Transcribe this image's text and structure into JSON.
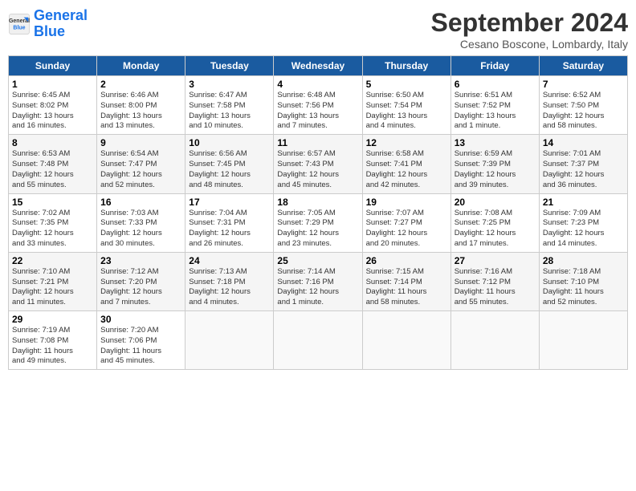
{
  "logo": {
    "line1": "General",
    "line2": "Blue"
  },
  "title": "September 2024",
  "subtitle": "Cesano Boscone, Lombardy, Italy",
  "weekdays": [
    "Sunday",
    "Monday",
    "Tuesday",
    "Wednesday",
    "Thursday",
    "Friday",
    "Saturday"
  ],
  "rows": [
    [
      {
        "day": "1",
        "lines": [
          "Sunrise: 6:45 AM",
          "Sunset: 8:02 PM",
          "Daylight: 13 hours",
          "and 16 minutes."
        ]
      },
      {
        "day": "2",
        "lines": [
          "Sunrise: 6:46 AM",
          "Sunset: 8:00 PM",
          "Daylight: 13 hours",
          "and 13 minutes."
        ]
      },
      {
        "day": "3",
        "lines": [
          "Sunrise: 6:47 AM",
          "Sunset: 7:58 PM",
          "Daylight: 13 hours",
          "and 10 minutes."
        ]
      },
      {
        "day": "4",
        "lines": [
          "Sunrise: 6:48 AM",
          "Sunset: 7:56 PM",
          "Daylight: 13 hours",
          "and 7 minutes."
        ]
      },
      {
        "day": "5",
        "lines": [
          "Sunrise: 6:50 AM",
          "Sunset: 7:54 PM",
          "Daylight: 13 hours",
          "and 4 minutes."
        ]
      },
      {
        "day": "6",
        "lines": [
          "Sunrise: 6:51 AM",
          "Sunset: 7:52 PM",
          "Daylight: 13 hours",
          "and 1 minute."
        ]
      },
      {
        "day": "7",
        "lines": [
          "Sunrise: 6:52 AM",
          "Sunset: 7:50 PM",
          "Daylight: 12 hours",
          "and 58 minutes."
        ]
      }
    ],
    [
      {
        "day": "8",
        "lines": [
          "Sunrise: 6:53 AM",
          "Sunset: 7:48 PM",
          "Daylight: 12 hours",
          "and 55 minutes."
        ]
      },
      {
        "day": "9",
        "lines": [
          "Sunrise: 6:54 AM",
          "Sunset: 7:47 PM",
          "Daylight: 12 hours",
          "and 52 minutes."
        ]
      },
      {
        "day": "10",
        "lines": [
          "Sunrise: 6:56 AM",
          "Sunset: 7:45 PM",
          "Daylight: 12 hours",
          "and 48 minutes."
        ]
      },
      {
        "day": "11",
        "lines": [
          "Sunrise: 6:57 AM",
          "Sunset: 7:43 PM",
          "Daylight: 12 hours",
          "and 45 minutes."
        ]
      },
      {
        "day": "12",
        "lines": [
          "Sunrise: 6:58 AM",
          "Sunset: 7:41 PM",
          "Daylight: 12 hours",
          "and 42 minutes."
        ]
      },
      {
        "day": "13",
        "lines": [
          "Sunrise: 6:59 AM",
          "Sunset: 7:39 PM",
          "Daylight: 12 hours",
          "and 39 minutes."
        ]
      },
      {
        "day": "14",
        "lines": [
          "Sunrise: 7:01 AM",
          "Sunset: 7:37 PM",
          "Daylight: 12 hours",
          "and 36 minutes."
        ]
      }
    ],
    [
      {
        "day": "15",
        "lines": [
          "Sunrise: 7:02 AM",
          "Sunset: 7:35 PM",
          "Daylight: 12 hours",
          "and 33 minutes."
        ]
      },
      {
        "day": "16",
        "lines": [
          "Sunrise: 7:03 AM",
          "Sunset: 7:33 PM",
          "Daylight: 12 hours",
          "and 30 minutes."
        ]
      },
      {
        "day": "17",
        "lines": [
          "Sunrise: 7:04 AM",
          "Sunset: 7:31 PM",
          "Daylight: 12 hours",
          "and 26 minutes."
        ]
      },
      {
        "day": "18",
        "lines": [
          "Sunrise: 7:05 AM",
          "Sunset: 7:29 PM",
          "Daylight: 12 hours",
          "and 23 minutes."
        ]
      },
      {
        "day": "19",
        "lines": [
          "Sunrise: 7:07 AM",
          "Sunset: 7:27 PM",
          "Daylight: 12 hours",
          "and 20 minutes."
        ]
      },
      {
        "day": "20",
        "lines": [
          "Sunrise: 7:08 AM",
          "Sunset: 7:25 PM",
          "Daylight: 12 hours",
          "and 17 minutes."
        ]
      },
      {
        "day": "21",
        "lines": [
          "Sunrise: 7:09 AM",
          "Sunset: 7:23 PM",
          "Daylight: 12 hours",
          "and 14 minutes."
        ]
      }
    ],
    [
      {
        "day": "22",
        "lines": [
          "Sunrise: 7:10 AM",
          "Sunset: 7:21 PM",
          "Daylight: 12 hours",
          "and 11 minutes."
        ]
      },
      {
        "day": "23",
        "lines": [
          "Sunrise: 7:12 AM",
          "Sunset: 7:20 PM",
          "Daylight: 12 hours",
          "and 7 minutes."
        ]
      },
      {
        "day": "24",
        "lines": [
          "Sunrise: 7:13 AM",
          "Sunset: 7:18 PM",
          "Daylight: 12 hours",
          "and 4 minutes."
        ]
      },
      {
        "day": "25",
        "lines": [
          "Sunrise: 7:14 AM",
          "Sunset: 7:16 PM",
          "Daylight: 12 hours",
          "and 1 minute."
        ]
      },
      {
        "day": "26",
        "lines": [
          "Sunrise: 7:15 AM",
          "Sunset: 7:14 PM",
          "Daylight: 11 hours",
          "and 58 minutes."
        ]
      },
      {
        "day": "27",
        "lines": [
          "Sunrise: 7:16 AM",
          "Sunset: 7:12 PM",
          "Daylight: 11 hours",
          "and 55 minutes."
        ]
      },
      {
        "day": "28",
        "lines": [
          "Sunrise: 7:18 AM",
          "Sunset: 7:10 PM",
          "Daylight: 11 hours",
          "and 52 minutes."
        ]
      }
    ],
    [
      {
        "day": "29",
        "lines": [
          "Sunrise: 7:19 AM",
          "Sunset: 7:08 PM",
          "Daylight: 11 hours",
          "and 49 minutes."
        ]
      },
      {
        "day": "30",
        "lines": [
          "Sunrise: 7:20 AM",
          "Sunset: 7:06 PM",
          "Daylight: 11 hours",
          "and 45 minutes."
        ]
      },
      null,
      null,
      null,
      null,
      null
    ]
  ]
}
